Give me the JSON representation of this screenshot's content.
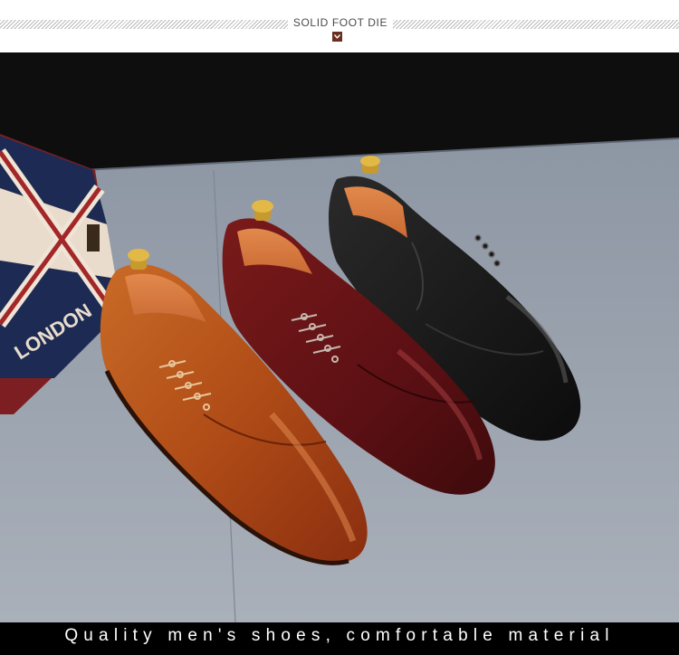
{
  "header": {
    "title": "SOLID FOOT DIE"
  },
  "photo": {
    "subject": "three pairs of men's dress shoes in brown, burgundy and black",
    "box_text": "LONDON",
    "colors": {
      "brown": "#b5561c",
      "burgundy": "#6e1416",
      "black": "#141414",
      "accent": "#6b2f21"
    }
  },
  "caption": {
    "text": "Quality men's shoes, comfortable material"
  }
}
